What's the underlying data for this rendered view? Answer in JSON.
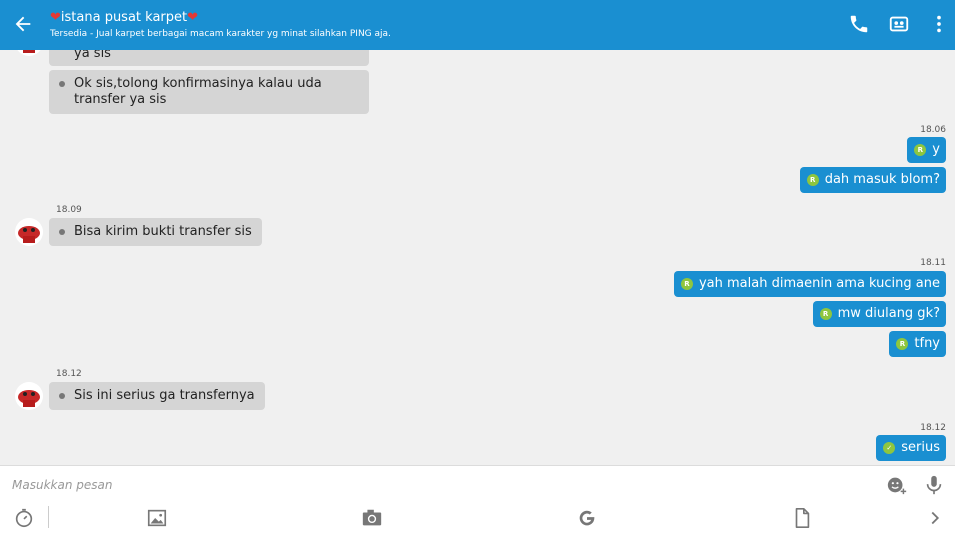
{
  "header": {
    "heart": "❤",
    "title": "istana pusat karpet",
    "subtitle": "Tersedia - Jual karpet berbagai macam karakter yg minat silahkan PING aja."
  },
  "messages": {
    "in_partial": "ya sis",
    "in1": "Ok sis,tolong konfirmasinya kalau uda transfer ya sis",
    "time_out1": "18.06",
    "out1": "y",
    "out2": "dah masuk blom?",
    "time_in1": "18.09",
    "in2": "Bisa kirim bukti transfer sis",
    "time_out2": "18.11",
    "out3": "yah malah dimaenin ama kucing ane",
    "out4": "mw diulang gk?",
    "out5": "tfny",
    "time_in2": "18.12",
    "in3": "Sis ini serius ga transfernya",
    "time_out3": "18.12",
    "out6": "serius"
  },
  "badge": {
    "read_letter": "R"
  },
  "composer": {
    "placeholder": "Masukkan pesan"
  },
  "colors": {
    "accent": "#1a8fd1",
    "incoming_bubble": "#d5d5d5",
    "badge": "#8ec63f"
  }
}
